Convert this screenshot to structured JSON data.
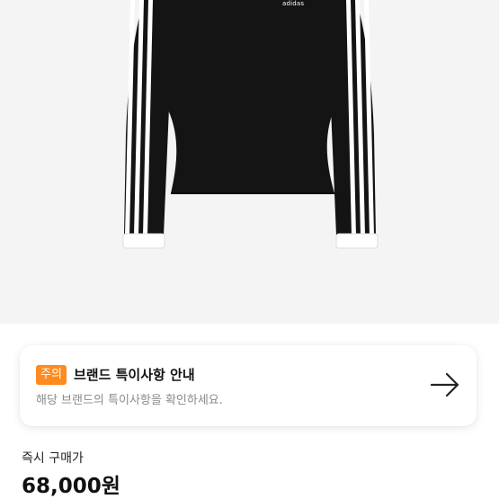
{
  "product": {
    "image_alt": "",
    "logo_text": "adidas"
  },
  "notice": {
    "badge": "주의",
    "title": "브랜드 특이사항 안내",
    "subtitle": "해당 브랜드의 특이사항을 확인하세요.",
    "action_icon": "arrow-right-icon"
  },
  "price": {
    "label": "즉시 구매가",
    "value": "68,000원"
  },
  "colors": {
    "badge": "#ff8a1f",
    "image_bg": "#f4f4f4",
    "garment": "#141414"
  }
}
